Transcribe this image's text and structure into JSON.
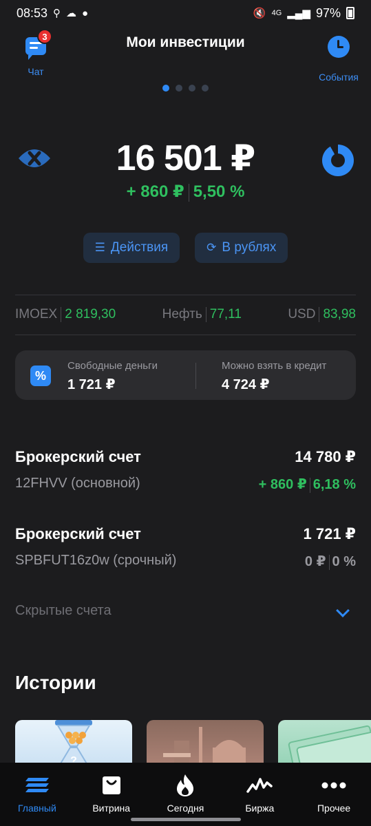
{
  "status_bar": {
    "time": "08:53",
    "battery": "97%",
    "network": "4G"
  },
  "header": {
    "title": "Мои инвестиции",
    "chat_label": "Чат",
    "chat_badge": "3",
    "events_label": "События"
  },
  "pager": {
    "pages": 4,
    "active": 0
  },
  "balance": {
    "total": "16 501 ₽",
    "change_abs": "+ 860 ₽",
    "change_pct": "5,50 %"
  },
  "actions": {
    "actions_label": "Действия",
    "currency_label": "В рублях"
  },
  "tickers": [
    {
      "name": "IMOEX",
      "value": "2 819,30"
    },
    {
      "name": "Нефть",
      "value": "77,11"
    },
    {
      "name": "USD",
      "value": "83,98"
    }
  ],
  "cash": {
    "free_label": "Свободные деньги",
    "free_amount": "1 721 ₽",
    "credit_label": "Можно взять в кредит",
    "credit_amount": "4 724 ₽"
  },
  "accounts": [
    {
      "name": "Брокерский счет",
      "amount": "14 780 ₽",
      "sub": "12FHVV (основной)",
      "change_abs": "+ 860 ₽",
      "change_pct": "6,18 %"
    },
    {
      "name": "Брокерский счет",
      "amount": "1 721 ₽",
      "sub": "SPBFUT16z0w (срочный)",
      "change_abs": "0 ₽",
      "change_pct": "0 %"
    }
  ],
  "hidden_accounts_label": "Скрытые счета",
  "stories": {
    "title": "Истории"
  },
  "tabbar": [
    {
      "label": "Главный",
      "icon": "home-stripes-icon"
    },
    {
      "label": "Витрина",
      "icon": "shopping-bag-icon"
    },
    {
      "label": "Сегодня",
      "icon": "flame-icon"
    },
    {
      "label": "Биржа",
      "icon": "market-chart-icon"
    },
    {
      "label": "Прочее",
      "icon": "more-dots-icon"
    }
  ],
  "colors": {
    "accent": "#2f8af5",
    "positive": "#2fbf5f",
    "badge": "#e9302f",
    "background": "#1c1c1e"
  }
}
